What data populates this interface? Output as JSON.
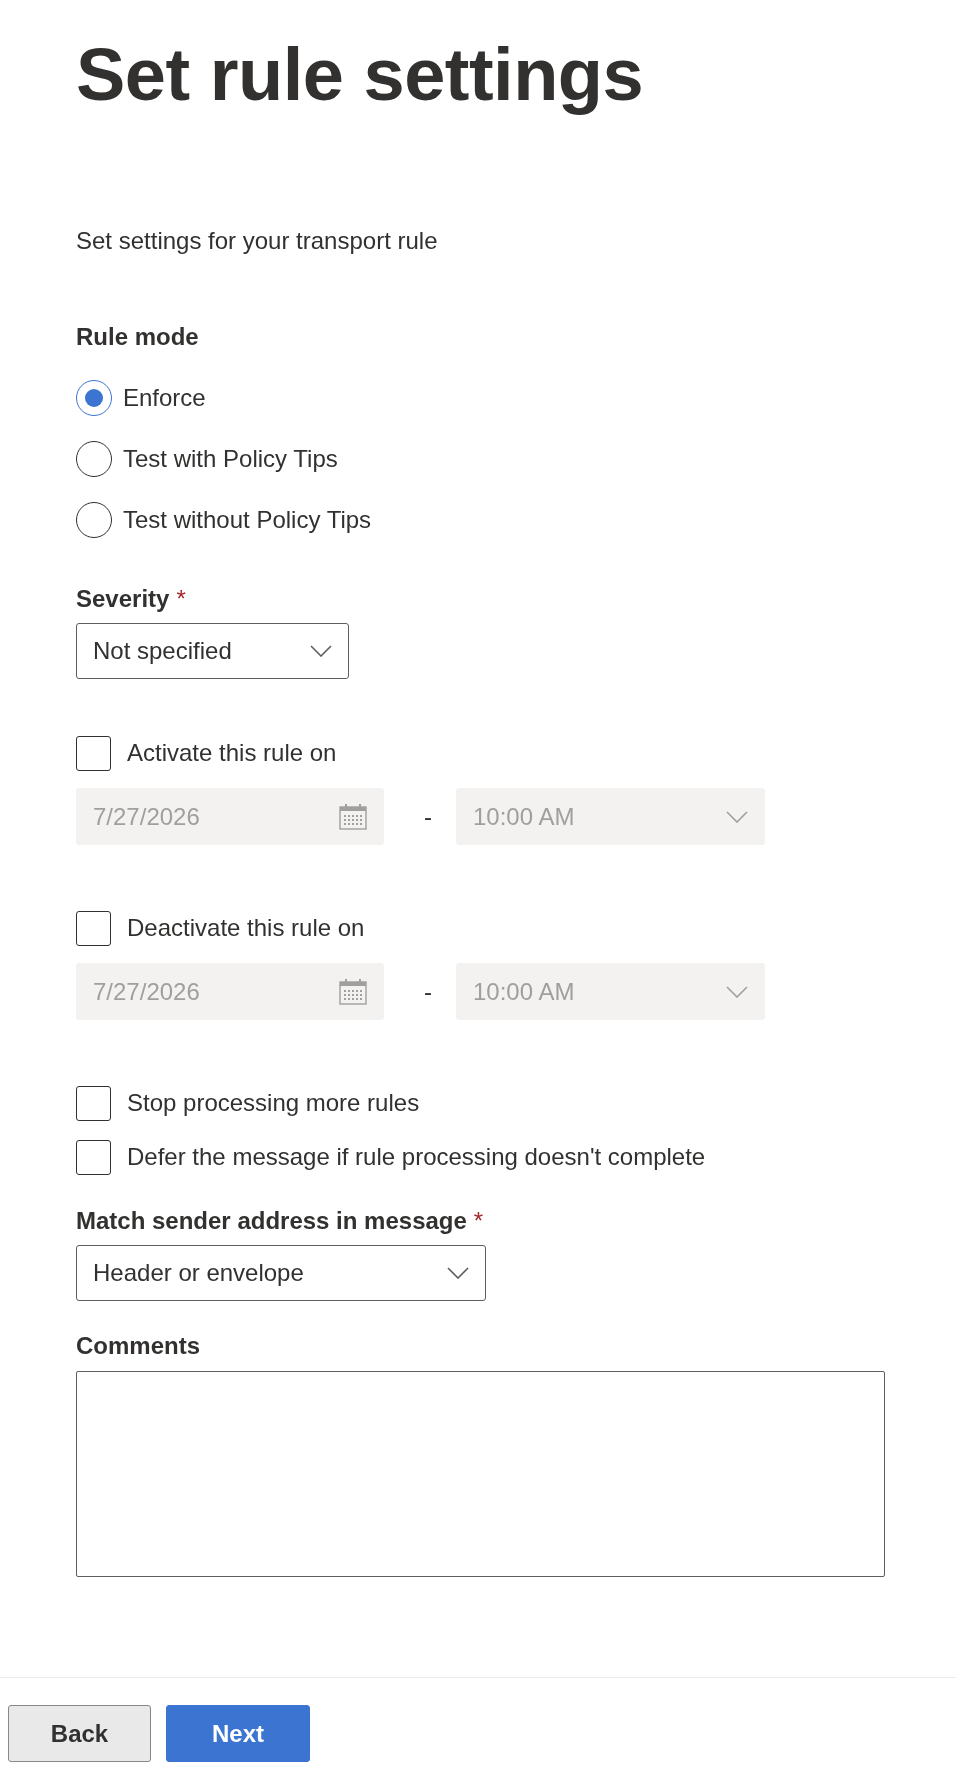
{
  "title": "Set rule settings",
  "description": "Set settings for your transport rule",
  "rule_mode": {
    "label": "Rule mode",
    "options": [
      {
        "label": "Enforce",
        "selected": true
      },
      {
        "label": "Test with Policy Tips",
        "selected": false
      },
      {
        "label": "Test without Policy Tips",
        "selected": false
      }
    ]
  },
  "severity": {
    "label": "Severity",
    "required_mark": "*",
    "value": "Not specified"
  },
  "schedule": [
    {
      "label": "Activate this rule on",
      "checked": false,
      "date": "7/27/2026",
      "separator": "-",
      "time": "10:00 AM",
      "disabled": true
    },
    {
      "label": "Deactivate this rule on",
      "checked": false,
      "date": "7/27/2026",
      "separator": "-",
      "time": "10:00 AM",
      "disabled": true
    }
  ],
  "options": [
    {
      "label": "Stop processing more rules",
      "checked": false
    },
    {
      "label": "Defer the message if rule processing doesn't complete",
      "checked": false
    }
  ],
  "match_sender": {
    "label": "Match sender address in message",
    "required_mark": "*",
    "value": "Header or envelope"
  },
  "comments": {
    "label": "Comments"
  },
  "buttons": [
    {
      "label": "Back",
      "kind": "secondary"
    },
    {
      "label": "Next",
      "kind": "primary"
    }
  ]
}
